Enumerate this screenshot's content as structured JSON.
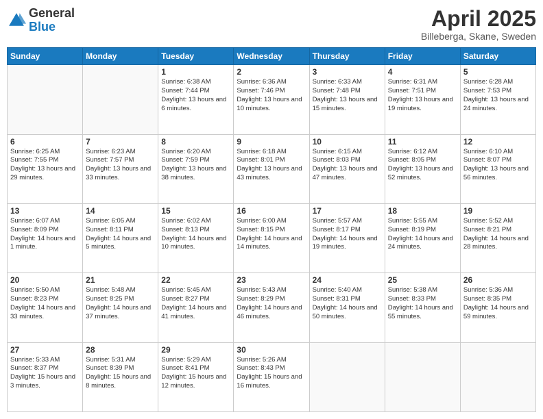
{
  "header": {
    "logo_general": "General",
    "logo_blue": "Blue",
    "title": "April 2025",
    "subtitle": "Billeberga, Skane, Sweden"
  },
  "weekdays": [
    "Sunday",
    "Monday",
    "Tuesday",
    "Wednesday",
    "Thursday",
    "Friday",
    "Saturday"
  ],
  "weeks": [
    [
      {
        "day": "",
        "info": ""
      },
      {
        "day": "",
        "info": ""
      },
      {
        "day": "1",
        "info": "Sunrise: 6:38 AM\nSunset: 7:44 PM\nDaylight: 13 hours and 6 minutes."
      },
      {
        "day": "2",
        "info": "Sunrise: 6:36 AM\nSunset: 7:46 PM\nDaylight: 13 hours and 10 minutes."
      },
      {
        "day": "3",
        "info": "Sunrise: 6:33 AM\nSunset: 7:48 PM\nDaylight: 13 hours and 15 minutes."
      },
      {
        "day": "4",
        "info": "Sunrise: 6:31 AM\nSunset: 7:51 PM\nDaylight: 13 hours and 19 minutes."
      },
      {
        "day": "5",
        "info": "Sunrise: 6:28 AM\nSunset: 7:53 PM\nDaylight: 13 hours and 24 minutes."
      }
    ],
    [
      {
        "day": "6",
        "info": "Sunrise: 6:25 AM\nSunset: 7:55 PM\nDaylight: 13 hours and 29 minutes."
      },
      {
        "day": "7",
        "info": "Sunrise: 6:23 AM\nSunset: 7:57 PM\nDaylight: 13 hours and 33 minutes."
      },
      {
        "day": "8",
        "info": "Sunrise: 6:20 AM\nSunset: 7:59 PM\nDaylight: 13 hours and 38 minutes."
      },
      {
        "day": "9",
        "info": "Sunrise: 6:18 AM\nSunset: 8:01 PM\nDaylight: 13 hours and 43 minutes."
      },
      {
        "day": "10",
        "info": "Sunrise: 6:15 AM\nSunset: 8:03 PM\nDaylight: 13 hours and 47 minutes."
      },
      {
        "day": "11",
        "info": "Sunrise: 6:12 AM\nSunset: 8:05 PM\nDaylight: 13 hours and 52 minutes."
      },
      {
        "day": "12",
        "info": "Sunrise: 6:10 AM\nSunset: 8:07 PM\nDaylight: 13 hours and 56 minutes."
      }
    ],
    [
      {
        "day": "13",
        "info": "Sunrise: 6:07 AM\nSunset: 8:09 PM\nDaylight: 14 hours and 1 minute."
      },
      {
        "day": "14",
        "info": "Sunrise: 6:05 AM\nSunset: 8:11 PM\nDaylight: 14 hours and 5 minutes."
      },
      {
        "day": "15",
        "info": "Sunrise: 6:02 AM\nSunset: 8:13 PM\nDaylight: 14 hours and 10 minutes."
      },
      {
        "day": "16",
        "info": "Sunrise: 6:00 AM\nSunset: 8:15 PM\nDaylight: 14 hours and 14 minutes."
      },
      {
        "day": "17",
        "info": "Sunrise: 5:57 AM\nSunset: 8:17 PM\nDaylight: 14 hours and 19 minutes."
      },
      {
        "day": "18",
        "info": "Sunrise: 5:55 AM\nSunset: 8:19 PM\nDaylight: 14 hours and 24 minutes."
      },
      {
        "day": "19",
        "info": "Sunrise: 5:52 AM\nSunset: 8:21 PM\nDaylight: 14 hours and 28 minutes."
      }
    ],
    [
      {
        "day": "20",
        "info": "Sunrise: 5:50 AM\nSunset: 8:23 PM\nDaylight: 14 hours and 33 minutes."
      },
      {
        "day": "21",
        "info": "Sunrise: 5:48 AM\nSunset: 8:25 PM\nDaylight: 14 hours and 37 minutes."
      },
      {
        "day": "22",
        "info": "Sunrise: 5:45 AM\nSunset: 8:27 PM\nDaylight: 14 hours and 41 minutes."
      },
      {
        "day": "23",
        "info": "Sunrise: 5:43 AM\nSunset: 8:29 PM\nDaylight: 14 hours and 46 minutes."
      },
      {
        "day": "24",
        "info": "Sunrise: 5:40 AM\nSunset: 8:31 PM\nDaylight: 14 hours and 50 minutes."
      },
      {
        "day": "25",
        "info": "Sunrise: 5:38 AM\nSunset: 8:33 PM\nDaylight: 14 hours and 55 minutes."
      },
      {
        "day": "26",
        "info": "Sunrise: 5:36 AM\nSunset: 8:35 PM\nDaylight: 14 hours and 59 minutes."
      }
    ],
    [
      {
        "day": "27",
        "info": "Sunrise: 5:33 AM\nSunset: 8:37 PM\nDaylight: 15 hours and 3 minutes."
      },
      {
        "day": "28",
        "info": "Sunrise: 5:31 AM\nSunset: 8:39 PM\nDaylight: 15 hours and 8 minutes."
      },
      {
        "day": "29",
        "info": "Sunrise: 5:29 AM\nSunset: 8:41 PM\nDaylight: 15 hours and 12 minutes."
      },
      {
        "day": "30",
        "info": "Sunrise: 5:26 AM\nSunset: 8:43 PM\nDaylight: 15 hours and 16 minutes."
      },
      {
        "day": "",
        "info": ""
      },
      {
        "day": "",
        "info": ""
      },
      {
        "day": "",
        "info": ""
      }
    ]
  ]
}
